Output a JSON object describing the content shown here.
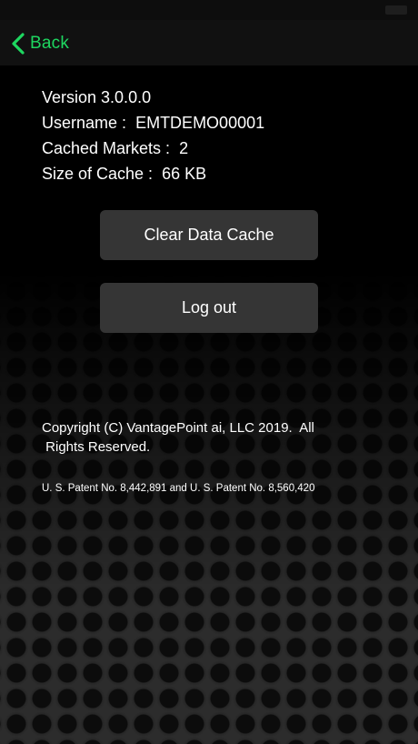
{
  "nav": {
    "back_label": "Back"
  },
  "info": {
    "version": "Version 3.0.0.0",
    "username_label": "Username :",
    "username_value": "EMTDEMO00001",
    "cached_markets_label": "Cached Markets :",
    "cached_markets_value": "2",
    "cache_size_label": "Size of Cache :",
    "cache_size_value": "66 KB"
  },
  "actions": {
    "clear_cache_label": "Clear Data Cache",
    "logout_label": "Log out"
  },
  "footer": {
    "copyright": "Copyright (C) VantagePoint ai, LLC 2019.  All\n Rights Reserved.",
    "patent": "U. S. Patent No. 8,442,891 and U. S. Patent No. 8,560,420"
  },
  "icons": {
    "back": "chevron-left-icon"
  },
  "colors": {
    "accent": "#1ed760",
    "background": "#000000",
    "button_background": "#353535"
  }
}
